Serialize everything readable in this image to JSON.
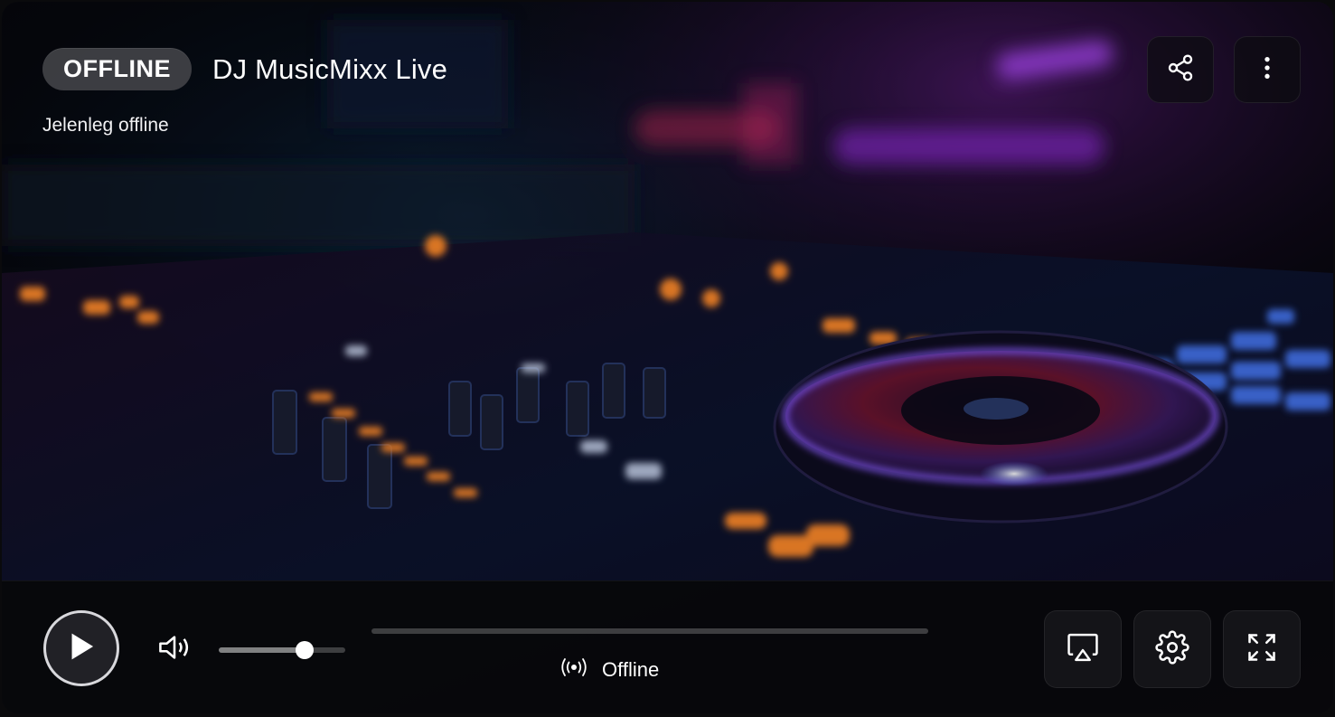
{
  "header": {
    "status_badge": "OFFLINE",
    "title": "DJ MusicMixx Live",
    "subtitle": "Jelenleg offline"
  },
  "top_actions": [
    {
      "icon": "share-icon"
    },
    {
      "icon": "more-vertical-icon"
    }
  ],
  "controls": {
    "play_icon": "play-icon",
    "volume_icon": "volume-icon",
    "volume_level": 0.68,
    "progress": 0,
    "live_status_icon": "broadcast-icon",
    "live_status": "Offline",
    "right_buttons": [
      {
        "icon": "airplay-icon"
      },
      {
        "icon": "settings-icon"
      },
      {
        "icon": "fullscreen-icon"
      }
    ]
  },
  "colors": {
    "accent_purple": "#9a3cff",
    "accent_blue": "#3a6bff",
    "accent_orange": "#ff7a1a",
    "text": "#ffffff"
  }
}
